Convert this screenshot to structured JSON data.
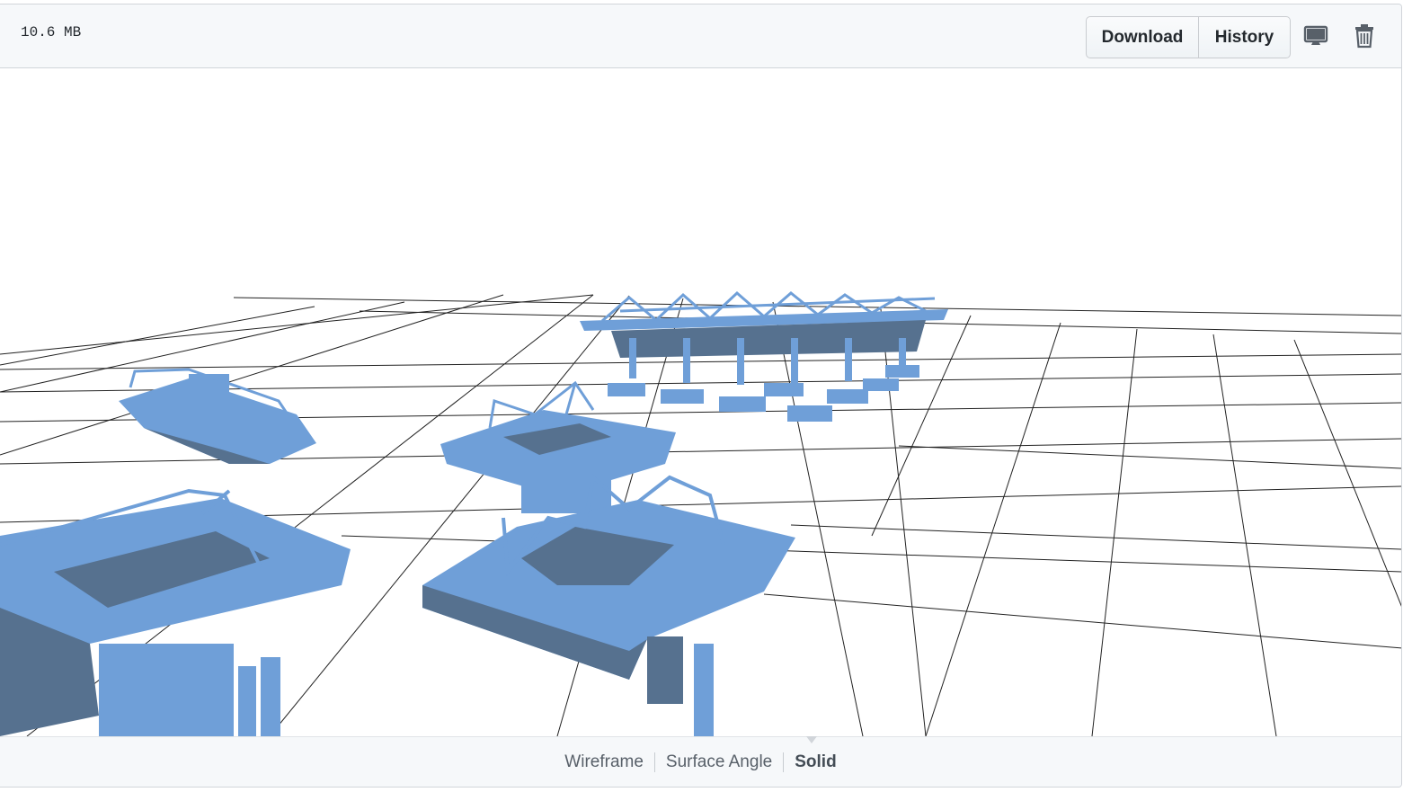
{
  "file": {
    "size": "10.6 MB"
  },
  "toolbar": {
    "download_label": "Download",
    "history_label": "History",
    "desktop_icon": "desktop-icon",
    "delete_icon": "trash-icon"
  },
  "viewer": {
    "model_color": "#6f9fd8",
    "model_shade": "#56718f",
    "grid_color": "#222222"
  },
  "render_modes": {
    "wireframe": "Wireframe",
    "surface_angle": "Surface Angle",
    "solid": "Solid",
    "active": "Solid"
  }
}
